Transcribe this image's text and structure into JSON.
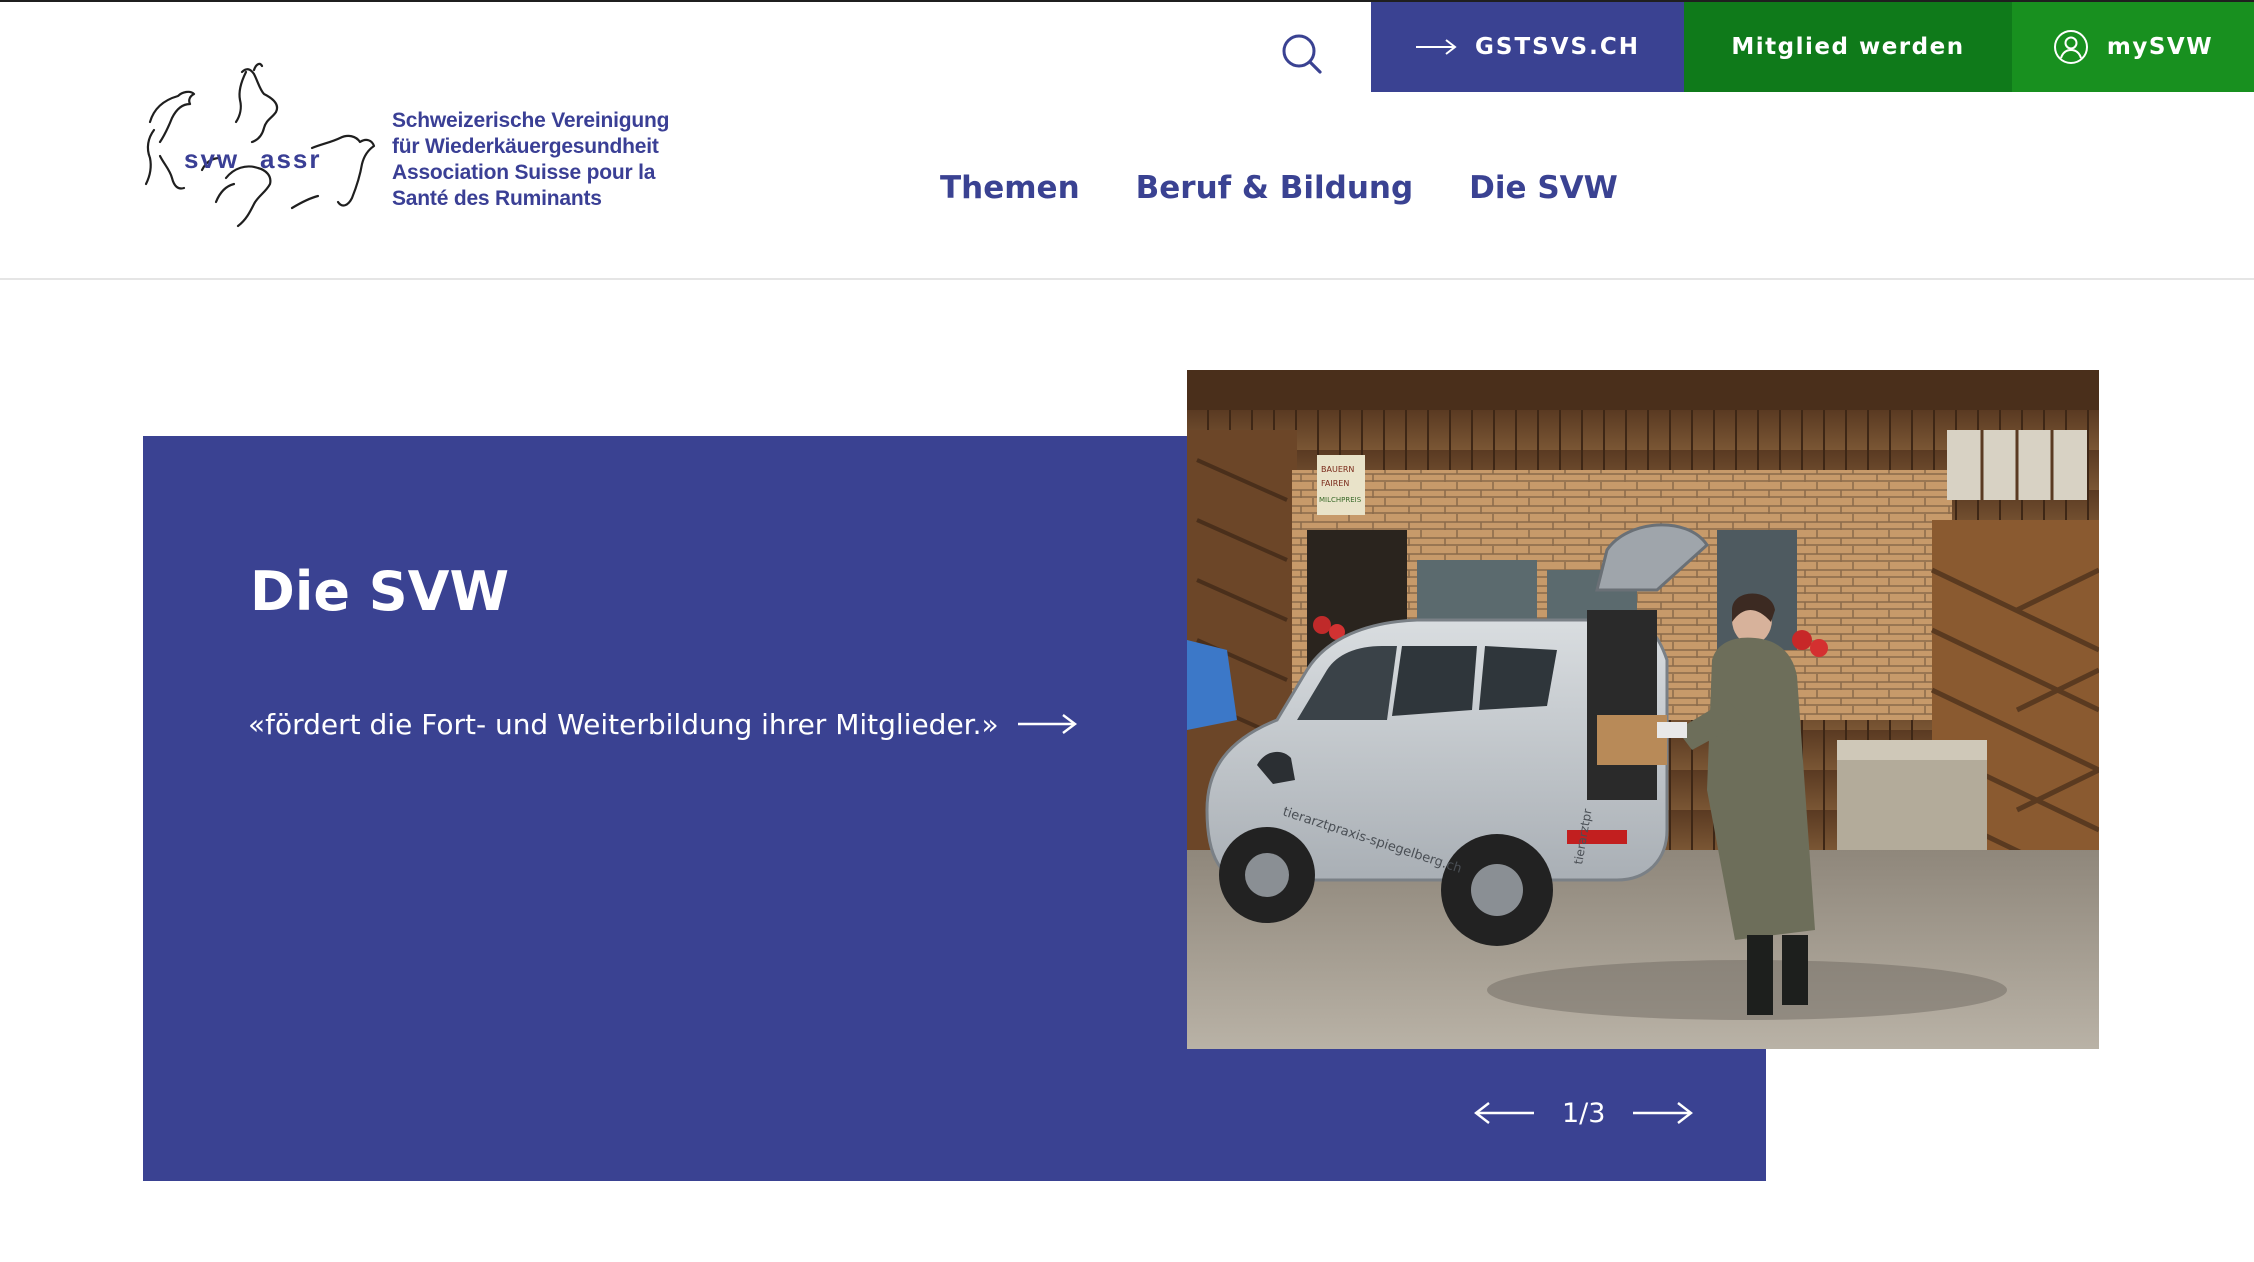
{
  "logo": {
    "wordmark_left": "svw",
    "wordmark_right": "assr",
    "lines": [
      "Schweizerische Vereinigung",
      "für Wiederkäuergesundheit",
      "Association Suisse pour la",
      "Santé des Ruminants"
    ]
  },
  "topbar": {
    "search_icon": "search-icon",
    "gst_label": "GSTSVS.CH",
    "member_label": "Mitglied werden",
    "mysvw_label": "mySVW"
  },
  "nav": {
    "items": [
      {
        "label": "Themen"
      },
      {
        "label": "Beruf & Bildung"
      },
      {
        "label": "Die SVW"
      }
    ]
  },
  "hero": {
    "title": "Die SVW",
    "text": "«fördert die Fort- und Weiterbildung ihrer Mitglieder.»",
    "photo_car_text": "tierarztpraxis-spiegelberg.ch",
    "photo_car_text2": "tierarztpr",
    "photo_sign": [
      "BAUERN",
      "FAIREN",
      "MILCHPREIS"
    ],
    "slider": {
      "counter": "1/3"
    }
  },
  "colors": {
    "brand_blue": "#3a4292",
    "brand_green_dark": "#0f7a1a",
    "brand_green": "#18901f",
    "white": "#ffffff"
  }
}
